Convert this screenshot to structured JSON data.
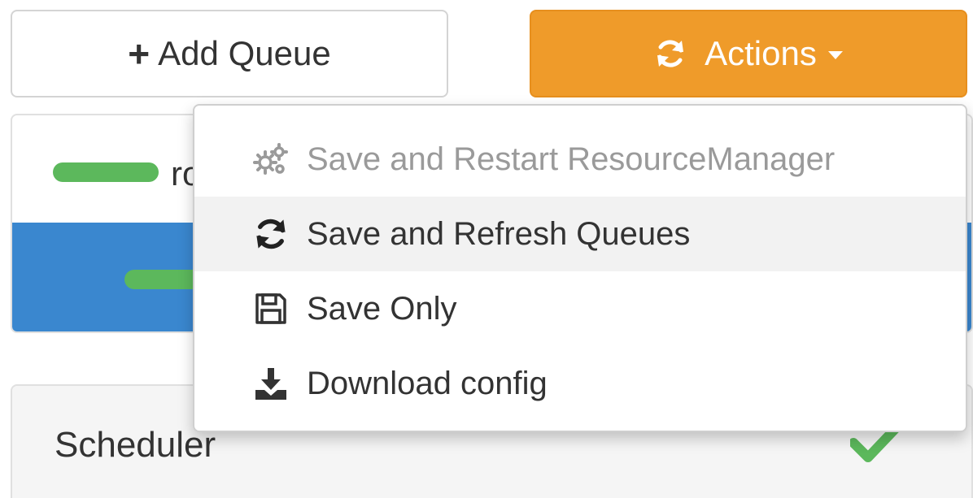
{
  "toolbar": {
    "add_queue_label": "Add Queue",
    "actions_label": "Actions"
  },
  "queue_tree": {
    "root_label_partial": "ro"
  },
  "actions_menu": {
    "items": [
      {
        "label": "Save and Restart ResourceManager",
        "icon": "gears-icon",
        "disabled": true
      },
      {
        "label": "Save and Refresh Queues",
        "icon": "refresh-icon",
        "disabled": false,
        "highlighted": true
      },
      {
        "label": "Save Only",
        "icon": "floppy-disk-icon",
        "disabled": false
      },
      {
        "label": "Download config",
        "icon": "download-icon",
        "disabled": false
      }
    ]
  },
  "scheduler": {
    "label": "Scheduler",
    "status_icon": "checkmark-icon"
  },
  "colors": {
    "actions_button": "#ef9b2a",
    "selected_row": "#3a87cf",
    "capacity_bar": "#5cb85c",
    "disabled_text": "#9a9a9a"
  }
}
